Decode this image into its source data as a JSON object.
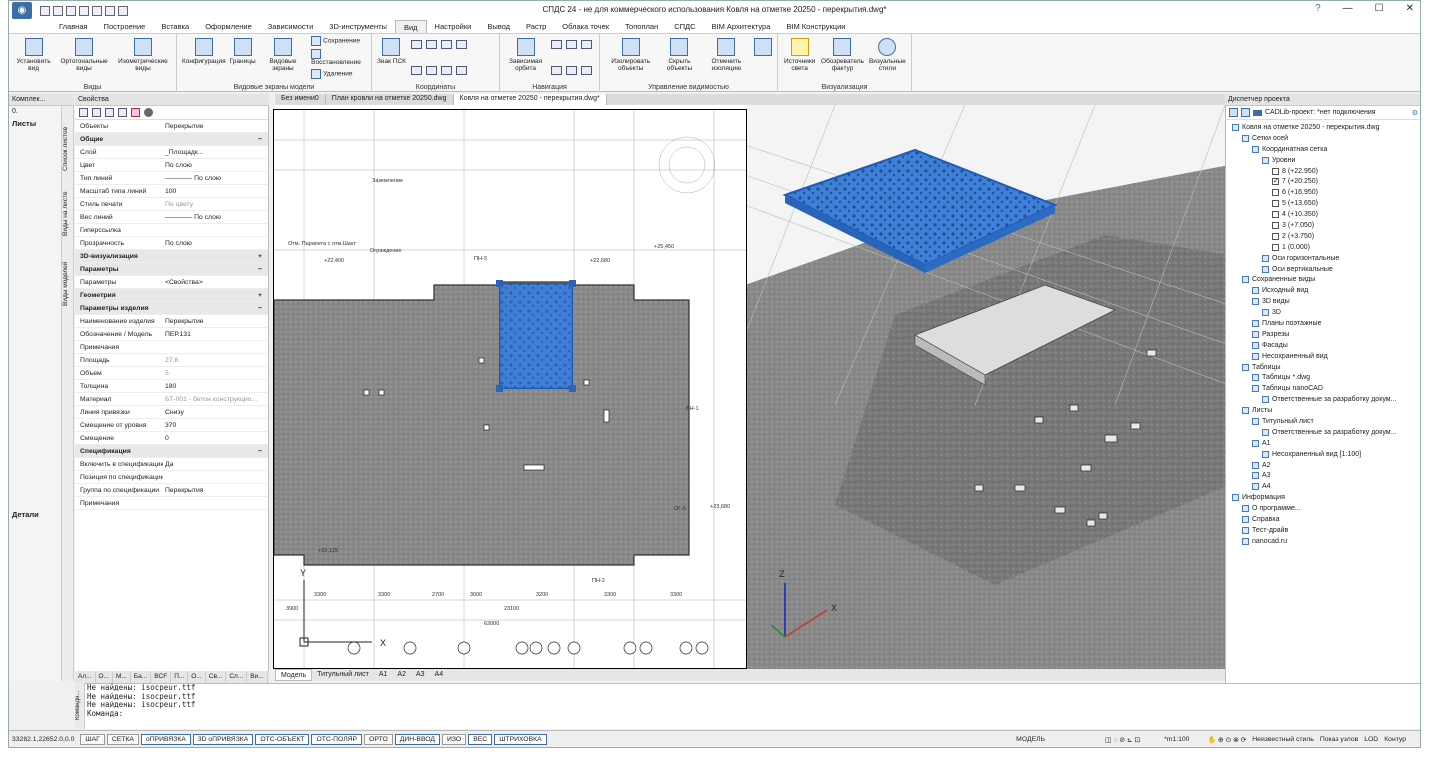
{
  "app": {
    "title": "СПДС 24 - не для коммерческого использования Ковля на отметке 20250 - перекрытия.dwg*"
  },
  "ribbon": {
    "tabs": [
      "Главная",
      "Построение",
      "Вставка",
      "Оформление",
      "Зависимости",
      "3D-инструменты",
      "Вид",
      "Настройки",
      "Вывод",
      "Растр",
      "Облака точек",
      "Топоплан",
      "СПДС",
      "BIM Архитектура",
      "BIM Конструкции"
    ],
    "groups": {
      "views": {
        "label": "Виды",
        "buttons": [
          "Установить вид",
          "Ортогональные виды",
          "Изометрические виды"
        ]
      },
      "viewports": {
        "label": "Видовые экраны модели",
        "buttons": [
          "Конфигурация",
          "Границы",
          "Видовые экраны"
        ],
        "small": [
          "Сохранение",
          "Восстановление",
          "Удаление"
        ]
      },
      "coords": {
        "label": "Координаты",
        "buttons": [
          "Знак ПСК"
        ]
      },
      "nav": {
        "label": "Навигация",
        "buttons": [
          "Зависимая орбита"
        ]
      },
      "visibility": {
        "label": "Управление видимостью",
        "buttons": [
          "Изолировать объекты",
          "Скрыть объекты",
          "Отменить изоляцию"
        ]
      },
      "visual": {
        "label": "Визуализация",
        "buttons": [
          "Источники света",
          "Обозреватель фактур",
          "Визуальные стили"
        ]
      }
    }
  },
  "left": {
    "header": "Комплек...",
    "combo": "0.",
    "sheets": "Листы",
    "details": "Детали",
    "vtabs": [
      "Список листов",
      "Виды на листе",
      "Виды моделей"
    ]
  },
  "props": {
    "header": "Свойства",
    "rows": [
      {
        "k": "Объекты",
        "v": "Перекрытие"
      },
      {
        "k": "Общие",
        "v": "−",
        "sec": true
      },
      {
        "k": "Слой",
        "v": "_Площадк..."
      },
      {
        "k": "Цвет",
        "v": "По слою"
      },
      {
        "k": "Тип линий",
        "v": "———— По слою"
      },
      {
        "k": "Масштаб типа линий",
        "v": "100"
      },
      {
        "k": "Стиль печати",
        "v": "По цвету",
        "dim": true
      },
      {
        "k": "Вес линий",
        "v": "———— По слою"
      },
      {
        "k": "Гиперссылка",
        "v": ""
      },
      {
        "k": "Прозрачность",
        "v": "По слою"
      },
      {
        "k": "3D-визуализация",
        "v": "+",
        "sec": true
      },
      {
        "k": "Параметры",
        "v": "−",
        "sec": true
      },
      {
        "k": "Параметры",
        "v": "<Свойства>"
      },
      {
        "k": "Геометрия",
        "v": "+",
        "sec": true
      },
      {
        "k": "Параметры изделия",
        "v": "−",
        "sec": true
      },
      {
        "k": "Наименование изделия",
        "v": "Перекрытие"
      },
      {
        "k": "Обозначение / Модель",
        "v": "ПЕР.131"
      },
      {
        "k": "Примечания",
        "v": ""
      },
      {
        "k": "Площадь",
        "v": "27.8",
        "dim": true
      },
      {
        "k": "Объем",
        "v": "5",
        "dim": true
      },
      {
        "k": "Толщина",
        "v": "180"
      },
      {
        "k": "Материал",
        "v": "БТ-001 - бетон конструкцио...",
        "dim": true
      },
      {
        "k": "Линия привязки",
        "v": "Снизу"
      },
      {
        "k": "Смещение от уровня",
        "v": "370"
      },
      {
        "k": "Смещение",
        "v": "0"
      },
      {
        "k": "Спецификация",
        "v": "−",
        "sec": true
      },
      {
        "k": "Включить в спецификацию",
        "v": "Да"
      },
      {
        "k": "Позиция по спецификации",
        "v": ""
      },
      {
        "k": "Группа по спецификации",
        "v": "Перекрытия"
      },
      {
        "k": "Примечания",
        "v": ""
      }
    ],
    "bottom_tabs": [
      "Ал...",
      "О...",
      "М...",
      "Ба...",
      "BCF",
      "П...",
      "О...",
      "Св...",
      "Сл...",
      "Ви..."
    ]
  },
  "doc_tabs": [
    "Без имени0",
    "План кровли на отметке 20250.dwg",
    "Ковля на отметке 20250 - перекрытия.dwg*"
  ],
  "model_tabs": [
    "Модель",
    "Титульный лист",
    "A1",
    "A2",
    "A3",
    "A4"
  ],
  "drawing": {
    "dims": [
      "3300",
      "3300",
      "2700",
      "3000",
      "3200",
      "3300",
      "3300",
      "3900",
      "23100",
      "63000"
    ],
    "marks": [
      "+22,400",
      "+22,125",
      "+22,680",
      "+25,450",
      "+23,680",
      "ПН-3",
      "ПН-2",
      "ВН-1",
      "ОГ-5"
    ],
    "axes": [
      "1/КА",
      "2/КА",
      "3/КА",
      "4/КА",
      "5/КА",
      "6/КА",
      "7/КА",
      "8/КА",
      "9/КА",
      "10/КА",
      "11/КА"
    ],
    "notes": [
      "Отм. Парапета с отм.Шахт",
      "Ограждение",
      "Заземление"
    ]
  },
  "project": {
    "header": "Диспетчер проекта",
    "status": "CADLib-проект: *нет подключения",
    "tree": [
      {
        "t": "Ковля на отметке 20250 - перекрытия.dwg",
        "l": 0
      },
      {
        "t": "Сетки осей",
        "l": 1
      },
      {
        "t": "Координатная сетка",
        "l": 2
      },
      {
        "t": "Уровни",
        "l": 3
      },
      {
        "t": "8 (+22.950)",
        "l": 4,
        "cb": ""
      },
      {
        "t": "7 (+20.250)",
        "l": 4,
        "cb": "✓"
      },
      {
        "t": "6 (+16.950)",
        "l": 4,
        "cb": ""
      },
      {
        "t": "5 (+13.650)",
        "l": 4,
        "cb": ""
      },
      {
        "t": "4 (+10.350)",
        "l": 4,
        "cb": ""
      },
      {
        "t": "3 (+7.050)",
        "l": 4,
        "cb": ""
      },
      {
        "t": "2 (+3.750)",
        "l": 4,
        "cb": ""
      },
      {
        "t": "1 (0.000)",
        "l": 4,
        "cb": ""
      },
      {
        "t": "Оси горизонтальные",
        "l": 3
      },
      {
        "t": "Оси вертикальные",
        "l": 3
      },
      {
        "t": "Сохраненные виды",
        "l": 1
      },
      {
        "t": "Исходный вид",
        "l": 2
      },
      {
        "t": "3D виды",
        "l": 2
      },
      {
        "t": "3D",
        "l": 3
      },
      {
        "t": "Планы поэтажные",
        "l": 2
      },
      {
        "t": "Разрезы",
        "l": 2
      },
      {
        "t": "Фасады",
        "l": 2
      },
      {
        "t": "Несохраненный вид",
        "l": 2
      },
      {
        "t": "Таблицы",
        "l": 1
      },
      {
        "t": "Таблицы *.dwg",
        "l": 2
      },
      {
        "t": "Таблицы nanoCAD",
        "l": 2
      },
      {
        "t": "Ответственные за разработку докум...",
        "l": 3
      },
      {
        "t": "Листы",
        "l": 1
      },
      {
        "t": "Титульный лист",
        "l": 2
      },
      {
        "t": "Ответственные за разработку докум...",
        "l": 3
      },
      {
        "t": "A1",
        "l": 2
      },
      {
        "t": "Несохраненный вид [1:100]",
        "l": 3
      },
      {
        "t": "A2",
        "l": 2
      },
      {
        "t": "A3",
        "l": 2
      },
      {
        "t": "A4",
        "l": 2
      },
      {
        "t": "Информация",
        "l": 0
      },
      {
        "t": "О программе...",
        "l": 1
      },
      {
        "t": "Справка",
        "l": 1
      },
      {
        "t": "Тест-драйв",
        "l": 1
      },
      {
        "t": "nanocad.ru",
        "l": 1
      }
    ]
  },
  "command": {
    "lines": [
      "Не найдены: isocpeur.ttf",
      "Не найдены: isocpeur.ttf",
      "Не найдены: isocpeur.ttf",
      "Команда:"
    ],
    "side": "Командн..."
  },
  "status": {
    "coords": "33282.1,22652.0,0.0",
    "toggles": [
      "ШАГ",
      "СЕТКА",
      "оПРИВЯЗКА",
      "3D оПРИВЯЗКА",
      "ОТС-ОБЪЕКТ",
      "ОТС-ПОЛЯР",
      "ОРТО",
      "ДИН-ВВОД",
      "ИЗО",
      "ВЕС",
      "ШТРИХОВКА"
    ],
    "on": [
      "оПРИВЯЗКА",
      "3D оПРИВЯЗКА",
      "ОТС-ОБЪЕКТ",
      "ОТС-ПОЛЯР",
      "ДИН-ВВОД",
      "ВЕС",
      "ШТРИХОВКА"
    ],
    "model": "МОДЕЛЬ",
    "scale": "*m1:100",
    "style": "Неизвестный стиль",
    "show_nodes": "Показ узлов",
    "lod": "LOD",
    "contour": "Контур"
  },
  "colors": {
    "accent": "#3a6ea5",
    "selection": "#2f6fd1"
  }
}
